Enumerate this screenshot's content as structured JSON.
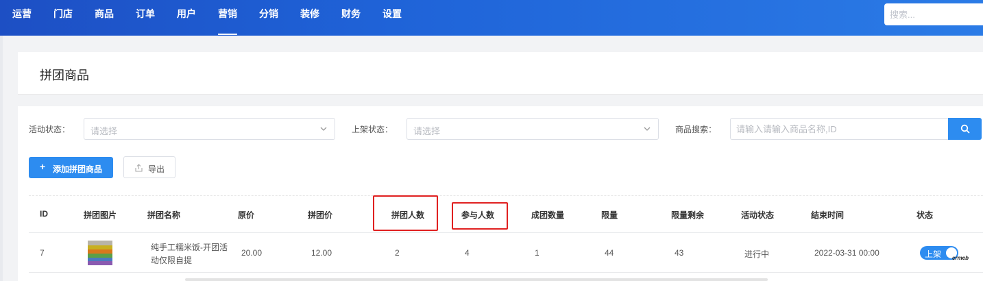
{
  "nav": {
    "items": [
      "运营",
      "门店",
      "商品",
      "订单",
      "用户",
      "营销",
      "分销",
      "装修",
      "财务",
      "设置"
    ],
    "active": "营销",
    "search_placeholder": "搜索..."
  },
  "page": {
    "title": "拼团商品"
  },
  "filters": {
    "activity_status_label": "活动状态：",
    "activity_status_placeholder": "请选择",
    "shelf_status_label": "上架状态：",
    "shelf_status_placeholder": "请选择",
    "product_search_label": "商品搜索：",
    "product_search_placeholder": "请输入请输入商品名称,ID"
  },
  "actions": {
    "add_label": "添加拼团商品",
    "add_icon": "+",
    "export_label": "导出"
  },
  "table": {
    "headers": [
      "ID",
      "拼团图片",
      "拼团名称",
      "原价",
      "拼团价",
      "拼团人数",
      "参与人数",
      "成团数量",
      "限量",
      "限量剩余",
      "活动状态",
      "结束时间",
      "状态"
    ],
    "rows": [
      {
        "id": "7",
        "name_line1": "纯手工糯米饭-开团活",
        "name_line2": "动仅限自提",
        "original_price": "20.00",
        "group_price": "12.00",
        "group_size": "2",
        "participants": "4",
        "groups_formed": "1",
        "limit": "44",
        "limit_remaining": "43",
        "activity_status": "进行中",
        "end_time": "2022-03-31 00:00",
        "status_label": "上架",
        "status_on": true
      }
    ]
  },
  "watermark": "crmeb",
  "colors": {
    "primary": "#2d8cf0",
    "nav_start": "#1d4fc4",
    "nav_end": "#2b7be6",
    "highlight": "#e02020"
  }
}
